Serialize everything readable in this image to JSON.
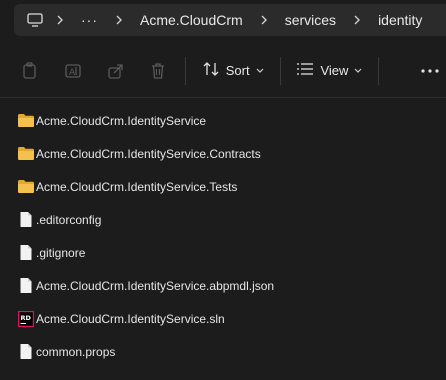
{
  "addressbar": {
    "crumbs": [
      "Acme.CloudCrm",
      "services",
      "identity"
    ],
    "more_label": "···"
  },
  "commandbar": {
    "sort_label": "Sort",
    "view_label": "View",
    "see_more_label": "•••"
  },
  "files": [
    {
      "name": "Acme.CloudCrm.IdentityService",
      "type": "folder"
    },
    {
      "name": "Acme.CloudCrm.IdentityService.Contracts",
      "type": "folder"
    },
    {
      "name": "Acme.CloudCrm.IdentityService.Tests",
      "type": "folder"
    },
    {
      "name": ".editorconfig",
      "type": "file"
    },
    {
      "name": ".gitignore",
      "type": "file"
    },
    {
      "name": "Acme.CloudCrm.IdentityService.abpmdl.json",
      "type": "file"
    },
    {
      "name": "Acme.CloudCrm.IdentityService.sln",
      "type": "rider-solution",
      "badge": "RD"
    },
    {
      "name": "common.props",
      "type": "file"
    }
  ],
  "colors": {
    "folder": "#f4c04e",
    "folder_dark": "#e0a82e",
    "rider_badge_bg": "#000000",
    "rider_badge_accent": "#dd1265"
  }
}
